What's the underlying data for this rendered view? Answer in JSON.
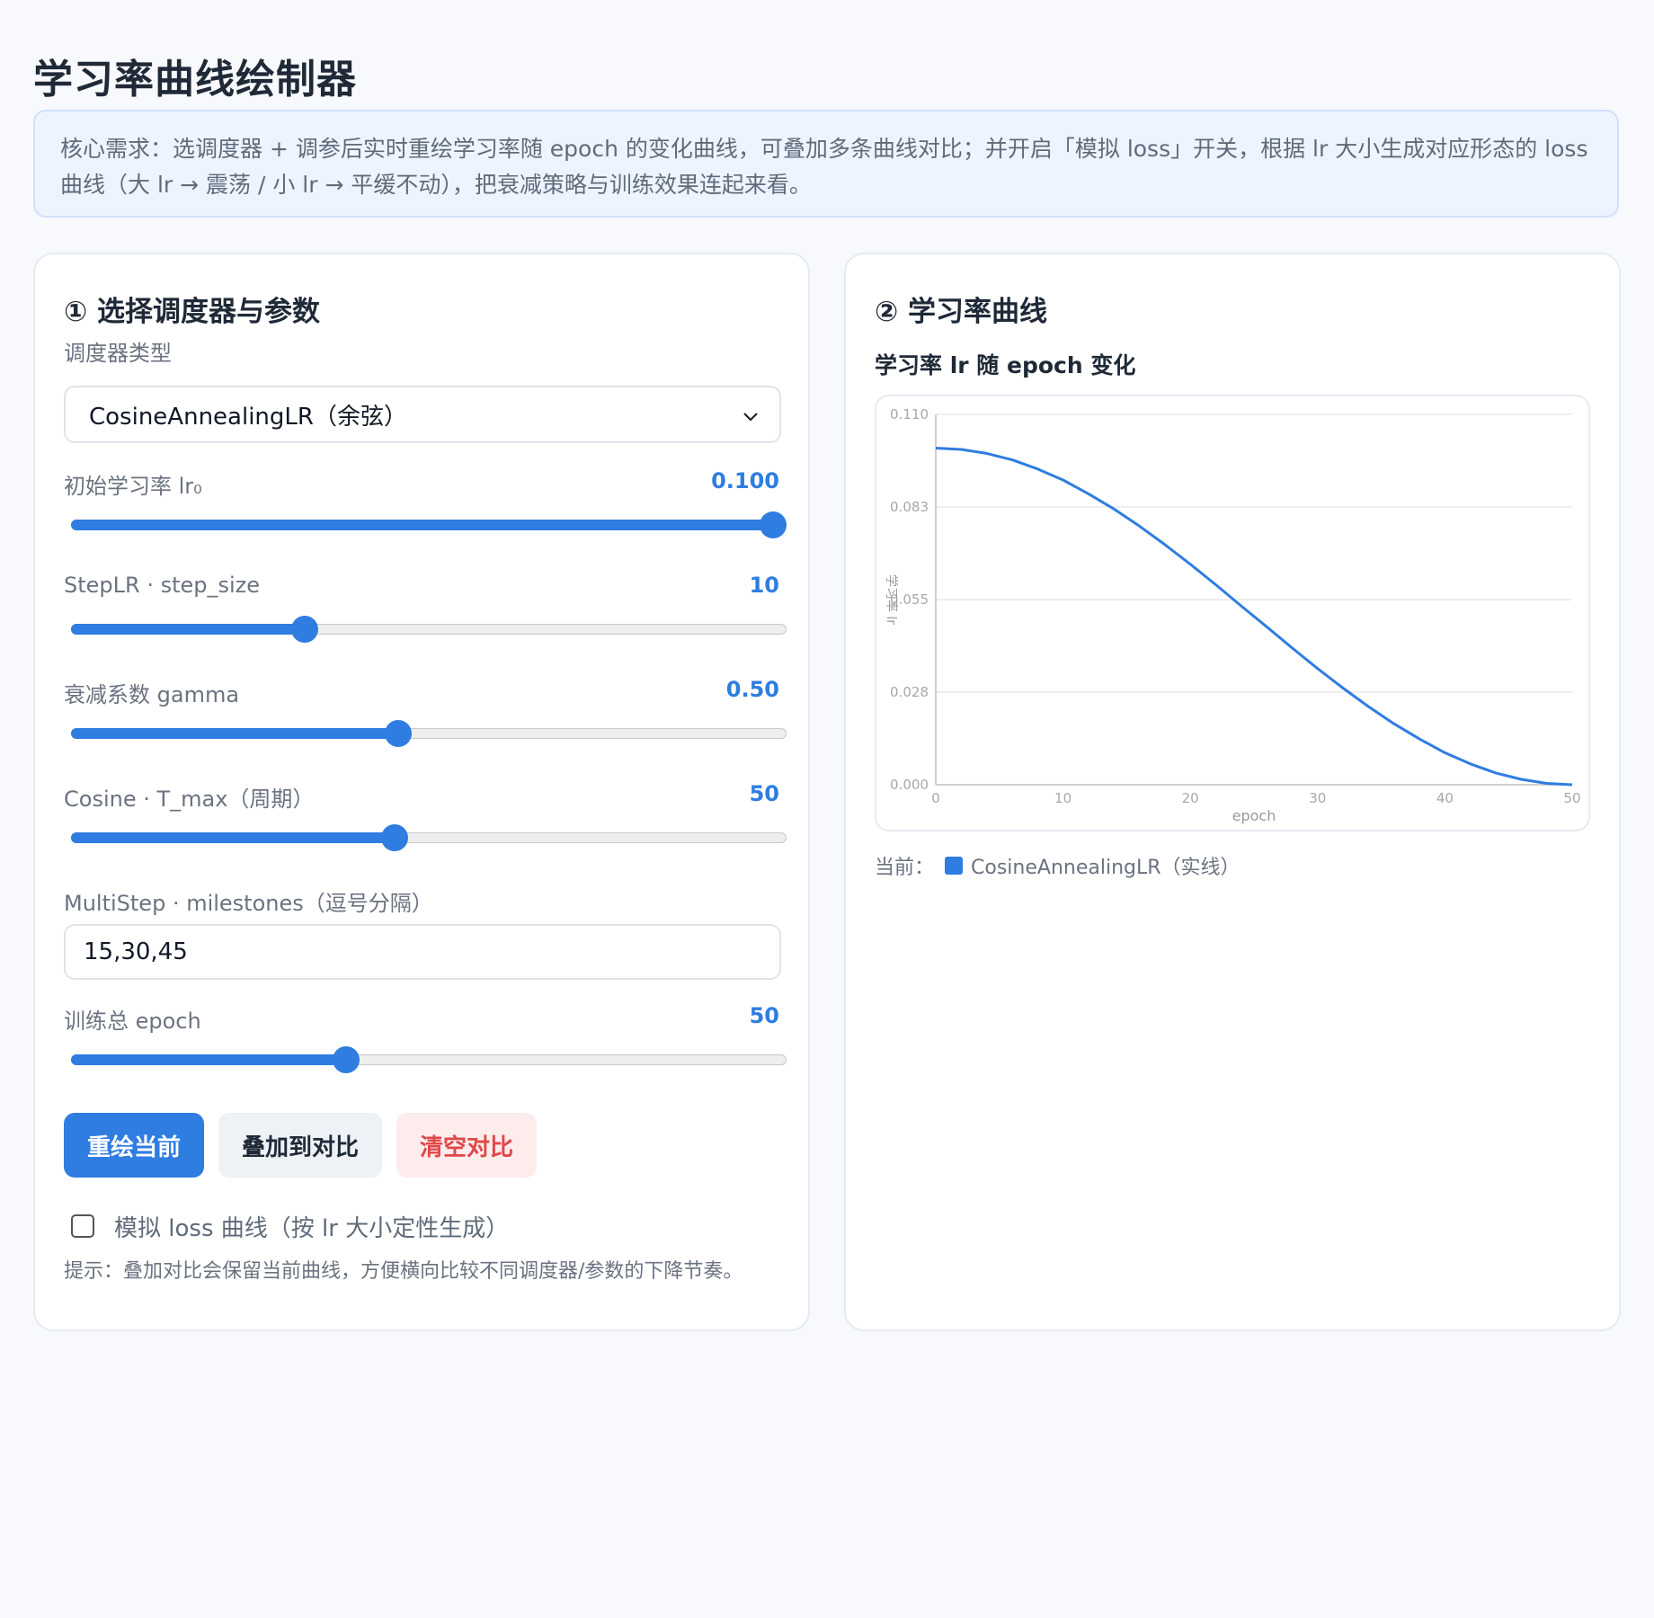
{
  "page": {
    "title": "学习率曲线绘制器",
    "notice": "核心需求：选调度器 + 调参后实时重绘学习率随 epoch 的变化曲线，可叠加多条曲线对比；并开启「模拟 loss」开关，根据 lr 大小生成对应形态的 loss 曲线（大 lr → 震荡 / 小 lr → 平缓不动），把衰减策略与训练效果连起来看。"
  },
  "left_panel": {
    "title": "① 选择调度器与参数",
    "scheduler": {
      "label": "调度器类型",
      "selected": "CosineAnnealingLR（余弦）"
    },
    "initial_lr": {
      "label": "初始学习率 lr₀",
      "value": "0.100",
      "fraction": 1.0
    },
    "step_size": {
      "label": "StepLR · step_size",
      "value": "10",
      "fraction": 0.32
    },
    "gamma": {
      "label": "衰减系数 gamma",
      "value": "0.50",
      "fraction": 0.455
    },
    "t_max": {
      "label": "Cosine · T_max（周期）",
      "value": "50",
      "fraction": 0.45
    },
    "milestones": {
      "label": "MultiStep · milestones（逗号分隔）",
      "value": "15,30,45"
    },
    "epochs": {
      "label": "训练总 epoch",
      "value": "50",
      "fraction": 0.38
    },
    "buttons": {
      "redraw": "重绘当前",
      "overlay": "叠加到对比",
      "clear": "清空对比"
    },
    "loss_toggle": {
      "label": "模拟 loss 曲线（按 lr 大小定性生成）",
      "checked": false
    },
    "hint": "提示：叠加对比会保留当前曲线，方便横向比较不同调度器/参数的下降节奏。"
  },
  "right_panel": {
    "title": "② 学习率曲线",
    "legend": {
      "prefix": "当前：",
      "label": "CosineAnnealingLR（实线）"
    }
  },
  "colors": {
    "accent": "#2f7de1",
    "danger": "#e04848"
  },
  "chart_data": {
    "type": "line",
    "title": "学习率 lr 随 epoch 变化",
    "xlabel": "epoch",
    "ylabel": "学习率 lr",
    "xlim": [
      0,
      50
    ],
    "ylim": [
      0,
      0.11
    ],
    "x_ticks": [
      "0",
      "10",
      "20",
      "30",
      "40",
      "50"
    ],
    "y_ticks": [
      "0.000",
      "0.028",
      "0.055",
      "0.083",
      "0.110"
    ],
    "grid": true,
    "series": [
      {
        "name": "CosineAnnealingLR",
        "color": "#2f7de1",
        "x": [
          0,
          2,
          4,
          6,
          8,
          10,
          12,
          14,
          16,
          18,
          20,
          22,
          24,
          26,
          28,
          30,
          32,
          34,
          36,
          38,
          40,
          42,
          44,
          46,
          48,
          50
        ],
        "y": [
          0.1,
          0.0996,
          0.0984,
          0.0965,
          0.0938,
          0.0905,
          0.0864,
          0.0819,
          0.0768,
          0.0713,
          0.0655,
          0.0594,
          0.0531,
          0.0469,
          0.0406,
          0.0345,
          0.0287,
          0.0232,
          0.0181,
          0.0136,
          0.0095,
          0.0062,
          0.0035,
          0.0016,
          0.0004,
          0.0
        ]
      }
    ]
  }
}
